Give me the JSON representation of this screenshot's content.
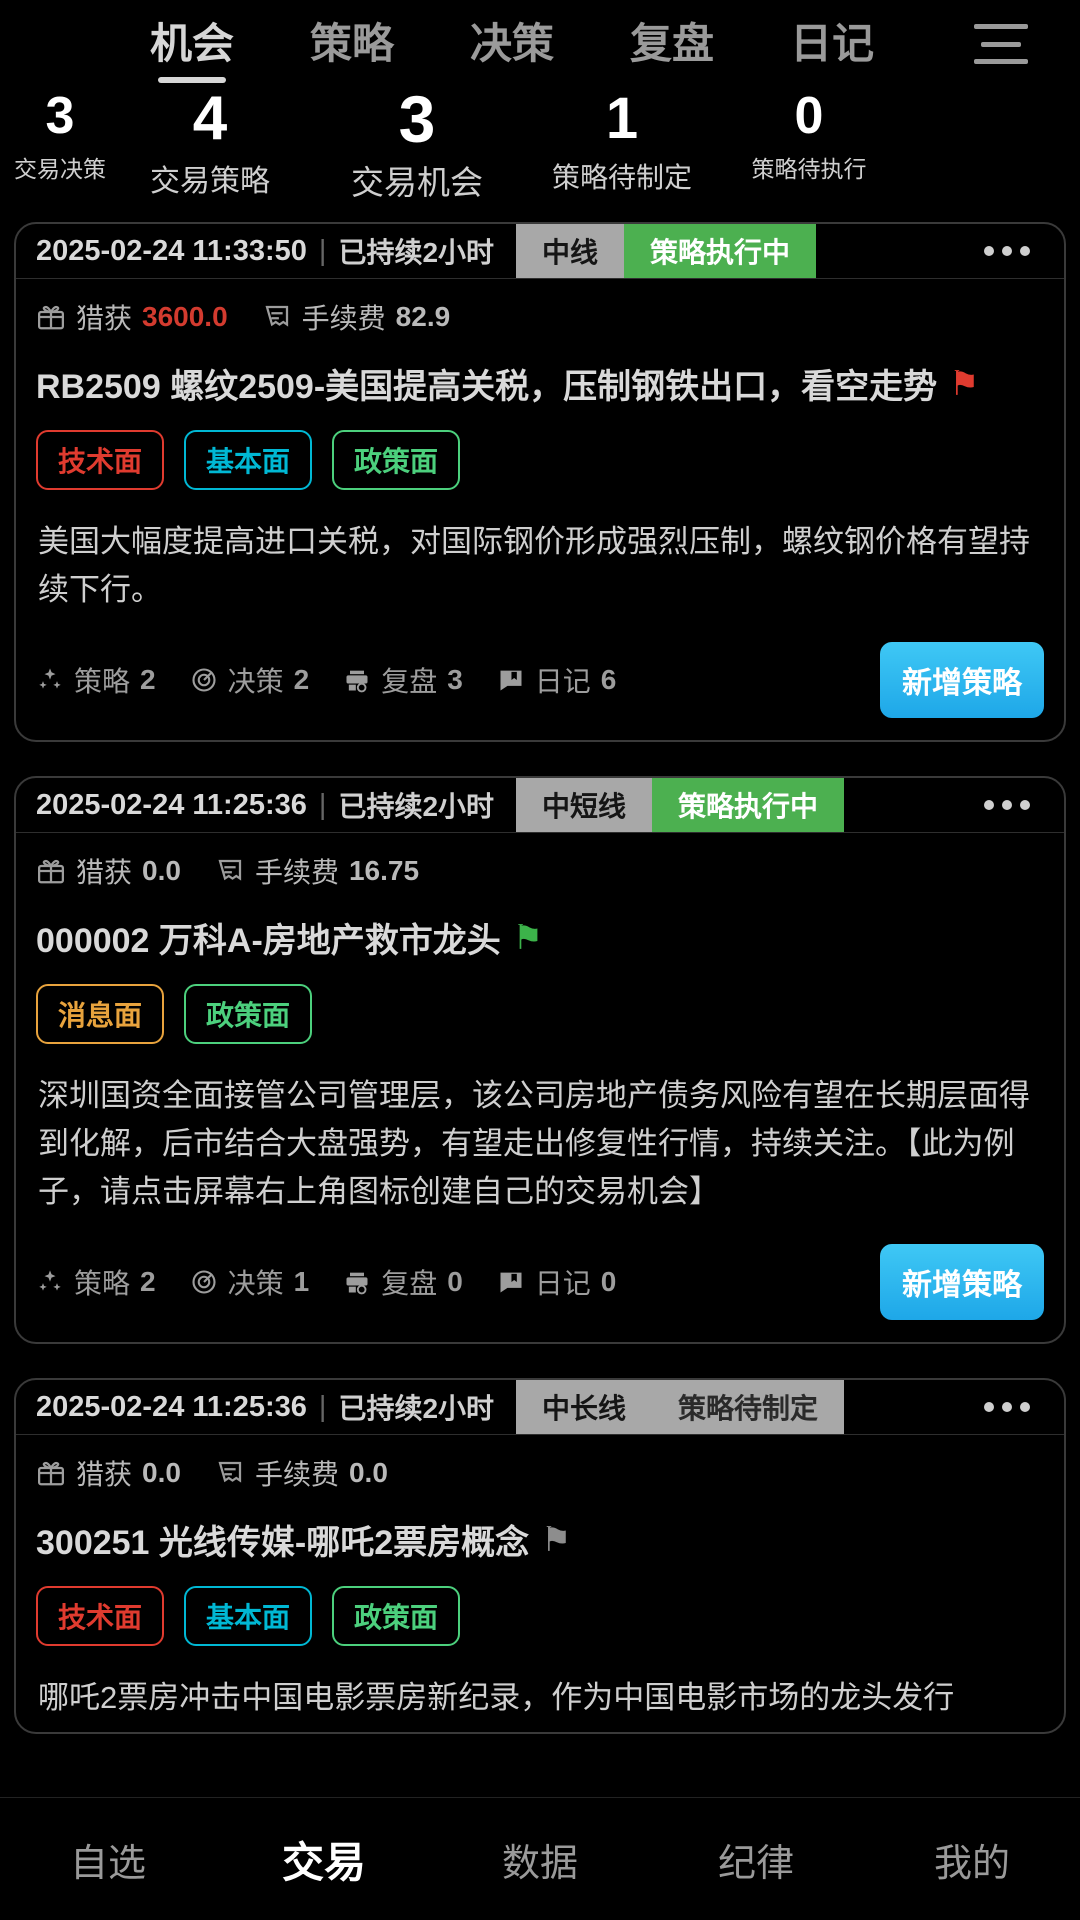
{
  "top_tabs": [
    {
      "label": "机会",
      "active": true
    },
    {
      "label": "策略",
      "active": false
    },
    {
      "label": "决策",
      "active": false
    },
    {
      "label": "复盘",
      "active": false
    },
    {
      "label": "日记",
      "active": false
    }
  ],
  "menu_icon": "hamburger-icon",
  "stats": [
    {
      "value": "3",
      "label": "交易决策"
    },
    {
      "value": "4",
      "label": "交易策略"
    },
    {
      "value": "3",
      "label": "交易机会"
    },
    {
      "value": "1",
      "label": "策略待制定"
    },
    {
      "value": "0",
      "label": "策略待执行"
    }
  ],
  "colors": {
    "accent_blue": "#1ea7e8",
    "status_running_bg": "#4cb050",
    "status_pending_bg": "#a8a8a8",
    "period_bg": "#a8a8a8",
    "profit_red": "#d33b2f",
    "tag_red": "#e03b2f",
    "tag_cyan": "#00b8d4",
    "tag_green": "#4cd07d",
    "tag_orange": "#e8a33d"
  },
  "cards": [
    {
      "time": "2025-02-24 11:33:50",
      "separator": "|",
      "duration": "已持续2小时",
      "period": "中线",
      "status": "策略执行中",
      "status_kind": "running",
      "more_icon": "more-options-icon",
      "metrics": [
        {
          "icon": "gift-icon",
          "label": "猎获",
          "value": "3600.0",
          "positive": true
        },
        {
          "icon": "receipt-icon",
          "label": "手续费",
          "value": "82.9",
          "positive": false
        }
      ],
      "title": "RB2509 螺纹2509-美国提高关税，压制钢铁出口，看空走势",
      "flag": "red",
      "tags": [
        {
          "label": "技术面",
          "color": "#e03b2f"
        },
        {
          "label": "基本面",
          "color": "#00b8d4"
        },
        {
          "label": "政策面",
          "color": "#4cd07d"
        }
      ],
      "description": "美国大幅度提高进口关税，对国际钢价形成强烈压制，螺纹钢价格有望持续下行。",
      "footer": [
        {
          "icon": "strategy-icon",
          "label": "策略",
          "count": "2"
        },
        {
          "icon": "decision-icon",
          "label": "决策",
          "count": "2"
        },
        {
          "icon": "review-icon",
          "label": "复盘",
          "count": "3"
        },
        {
          "icon": "journal-icon",
          "label": "日记",
          "count": "6"
        }
      ],
      "add_button": "新增策略"
    },
    {
      "time": "2025-02-24 11:25:36",
      "separator": "|",
      "duration": "已持续2小时",
      "period": "中短线",
      "status": "策略执行中",
      "status_kind": "running",
      "more_icon": "more-options-icon",
      "metrics": [
        {
          "icon": "gift-icon",
          "label": "猎获",
          "value": "0.0",
          "positive": false
        },
        {
          "icon": "receipt-icon",
          "label": "手续费",
          "value": "16.75",
          "positive": false
        }
      ],
      "title": "000002 万科A-房地产救市龙头",
      "flag": "green",
      "tags": [
        {
          "label": "消息面",
          "color": "#e8a33d"
        },
        {
          "label": "政策面",
          "color": "#4cd07d"
        }
      ],
      "description": "深圳国资全面接管公司管理层，该公司房地产债务风险有望在长期层面得到化解，后市结合大盘强势，有望走出修复性行情，持续关注。【此为例子，请点击屏幕右上角图标创建自己的交易机会】",
      "footer": [
        {
          "icon": "strategy-icon",
          "label": "策略",
          "count": "2"
        },
        {
          "icon": "decision-icon",
          "label": "决策",
          "count": "1"
        },
        {
          "icon": "review-icon",
          "label": "复盘",
          "count": "0"
        },
        {
          "icon": "journal-icon",
          "label": "日记",
          "count": "0"
        }
      ],
      "add_button": "新增策略"
    },
    {
      "time": "2025-02-24 11:25:36",
      "separator": "|",
      "duration": "已持续2小时",
      "period": "中长线",
      "status": "策略待制定",
      "status_kind": "pending",
      "more_icon": "more-options-icon",
      "metrics": [
        {
          "icon": "gift-icon",
          "label": "猎获",
          "value": "0.0",
          "positive": false
        },
        {
          "icon": "receipt-icon",
          "label": "手续费",
          "value": "0.0",
          "positive": false
        }
      ],
      "title": "300251 光线传媒-哪吒2票房概念",
      "flag": "gray",
      "tags": [
        {
          "label": "技术面",
          "color": "#e03b2f"
        },
        {
          "label": "基本面",
          "color": "#00b8d4"
        },
        {
          "label": "政策面",
          "color": "#4cd07d"
        }
      ],
      "description": "哪吒2票房冲击中国电影票房新纪录，作为中国电影市场的龙头发行",
      "footer": [],
      "add_button": ""
    }
  ],
  "bottom_nav": [
    {
      "label": "自选",
      "active": false
    },
    {
      "label": "交易",
      "active": true
    },
    {
      "label": "数据",
      "active": false
    },
    {
      "label": "纪律",
      "active": false
    },
    {
      "label": "我的",
      "active": false
    }
  ]
}
